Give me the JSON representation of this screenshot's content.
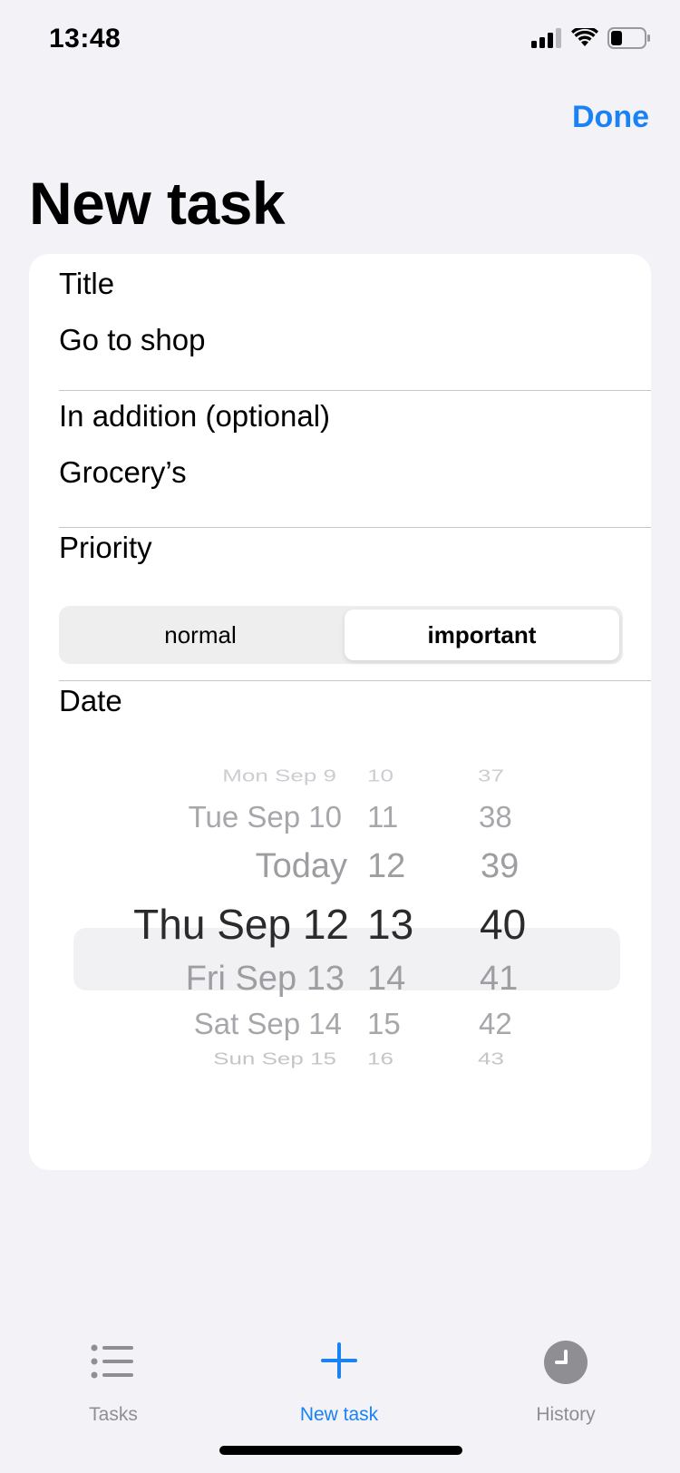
{
  "status": {
    "time": "13:48"
  },
  "header": {
    "done_label": "Done",
    "title": "New task"
  },
  "form": {
    "title_label": "Title",
    "title_value": "Go to shop",
    "addition_label": "In addition (optional)",
    "addition_value": "Grocery’s",
    "priority_label": "Priority",
    "priority_options": [
      "normal",
      "important"
    ],
    "priority_selected": "important",
    "date_label": "Date"
  },
  "date_picker": {
    "days": [
      "Mon Sep 9",
      "Tue Sep 10",
      "Today",
      "Thu Sep 12",
      "Fri Sep 13",
      "Sat Sep 14",
      "Sun Sep 15"
    ],
    "hours": [
      "10",
      "11",
      "12",
      "13",
      "14",
      "15",
      "16"
    ],
    "minutes": [
      "37",
      "38",
      "39",
      "40",
      "41",
      "42",
      "43"
    ],
    "selected": {
      "day": "Thu Sep 12",
      "hour": "13",
      "minute": "40"
    }
  },
  "tabs": [
    {
      "label": "Tasks",
      "icon": "list-icon"
    },
    {
      "label": "New task",
      "icon": "plus-icon",
      "active": true
    },
    {
      "label": "History",
      "icon": "clock-icon"
    }
  ],
  "colors": {
    "accent": "#1a82f5",
    "inactive": "#8e8e93",
    "background": "#f2f2f7"
  }
}
